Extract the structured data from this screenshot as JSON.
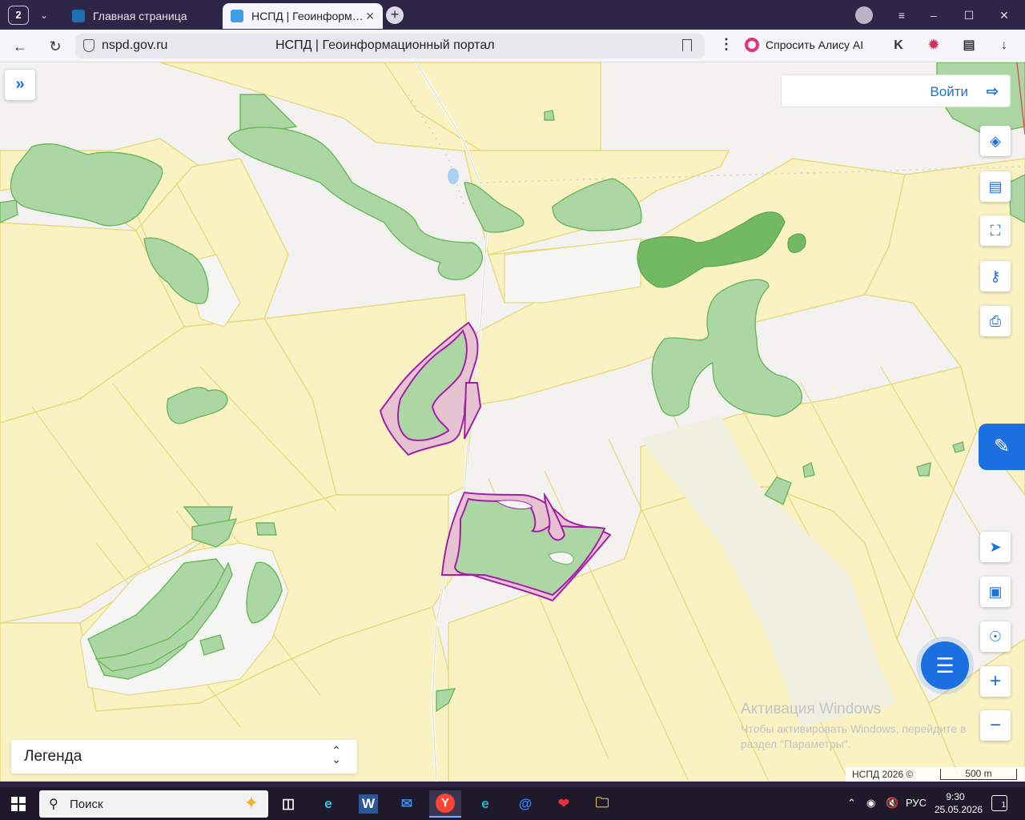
{
  "browser": {
    "tab_count": "2",
    "tabs": [
      {
        "label": "Главная страница",
        "active": false
      },
      {
        "label": "НСПД | Геоинформаци",
        "active": true
      }
    ],
    "url_domain": "nspd.gov.ru",
    "page_title": "НСПД | Геоинформационный портал",
    "alice_label": "Спросить Алису AI"
  },
  "map": {
    "login_label": "Войти",
    "legend_label": "Легенда",
    "attribution": "НСПД 2026 ©",
    "scale_label": "500 m",
    "toolbar_top": [
      "layers-icon",
      "ruler-icon",
      "select-area-icon",
      "share-icon",
      "print-icon"
    ],
    "toolbar_bottom": [
      "locate-icon",
      "picture-in-picture-icon",
      "search-location-icon",
      "zoom-in-icon",
      "zoom-out-icon"
    ],
    "colors": {
      "background": "#f3f2f0",
      "parcel_fill": "#faf2c2",
      "parcel_stroke": "#e8da7e",
      "forest_fill": "#acd7a4",
      "forest_stroke": "#6ab85b",
      "forest_dark": "#73b862",
      "highlight_stroke": "#a220a8",
      "highlight_fill": "#e7c3d2",
      "accent": "#1c6fe0"
    }
  },
  "watermark": {
    "line1": "Активация Windows",
    "line2": "Чтобы активировать Windows, перейдите в раздел \"Параметры\"."
  },
  "taskbar": {
    "search_label": "Поиск",
    "language": "РУС",
    "time": "9:30",
    "date": "25.05.2026",
    "notifications": "1"
  }
}
